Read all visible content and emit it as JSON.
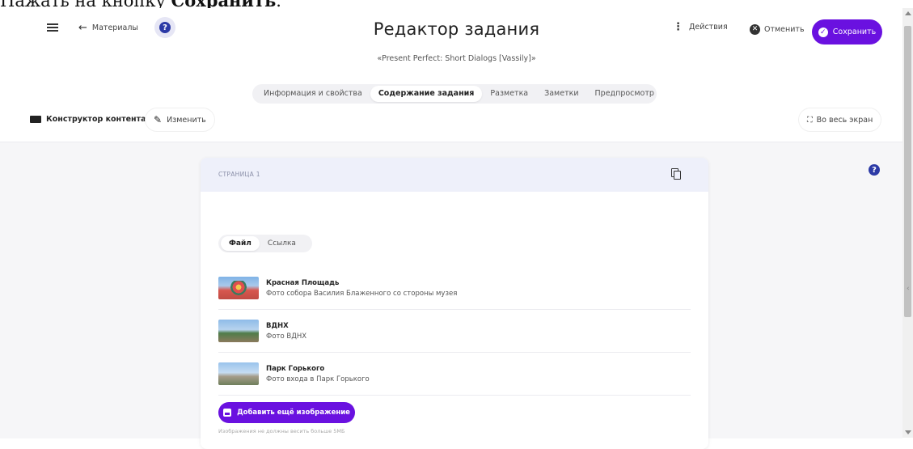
{
  "caption": {
    "prefix": "Нажать на кнопку ",
    "bold": "Сохранить",
    "suffix": "."
  },
  "header": {
    "back_label": "Материалы",
    "help_symbol": "?",
    "title": "Редактор задания",
    "subtitle": "«Present Perfect: Short Dialogs [Vassily]»",
    "actions_label": "Действия",
    "cancel_label": "Отменить",
    "save_label": "Сохранить"
  },
  "tabs": [
    {
      "label": "Информация и свойства",
      "active": false
    },
    {
      "label": "Содержание задания",
      "active": true
    },
    {
      "label": "Разметка",
      "active": false
    },
    {
      "label": "Заметки",
      "active": false
    },
    {
      "label": "Предпросмотр",
      "active": false
    }
  ],
  "toolbar": {
    "constructor_label": "Конструктор контента",
    "edit_label": "Изменить",
    "fullscreen_label": "Во весь экран"
  },
  "page": {
    "label": "СТРАНИЦА 1",
    "source_switch": {
      "file_label": "Файл",
      "link_label": "Ссылка",
      "selected": "Файл"
    },
    "images": [
      {
        "title": "Красная Площадь",
        "description": "Фото собора Василия Блаженного со стороны музея",
        "thumb": "red-square"
      },
      {
        "title": "ВДНХ",
        "description": "Фото ВДНХ",
        "thumb": "vdnh"
      },
      {
        "title": "Парк Горького",
        "description": "Фото входа в Парк Горького",
        "thumb": "gorky-park"
      }
    ],
    "add_image_label": "Добавить ещё изображение",
    "size_note": "Изображения не должны весить больше 5МБ"
  },
  "colors": {
    "accent": "#6a11e0",
    "help": "#2c3aa6",
    "header_band": "#eef0fa"
  }
}
